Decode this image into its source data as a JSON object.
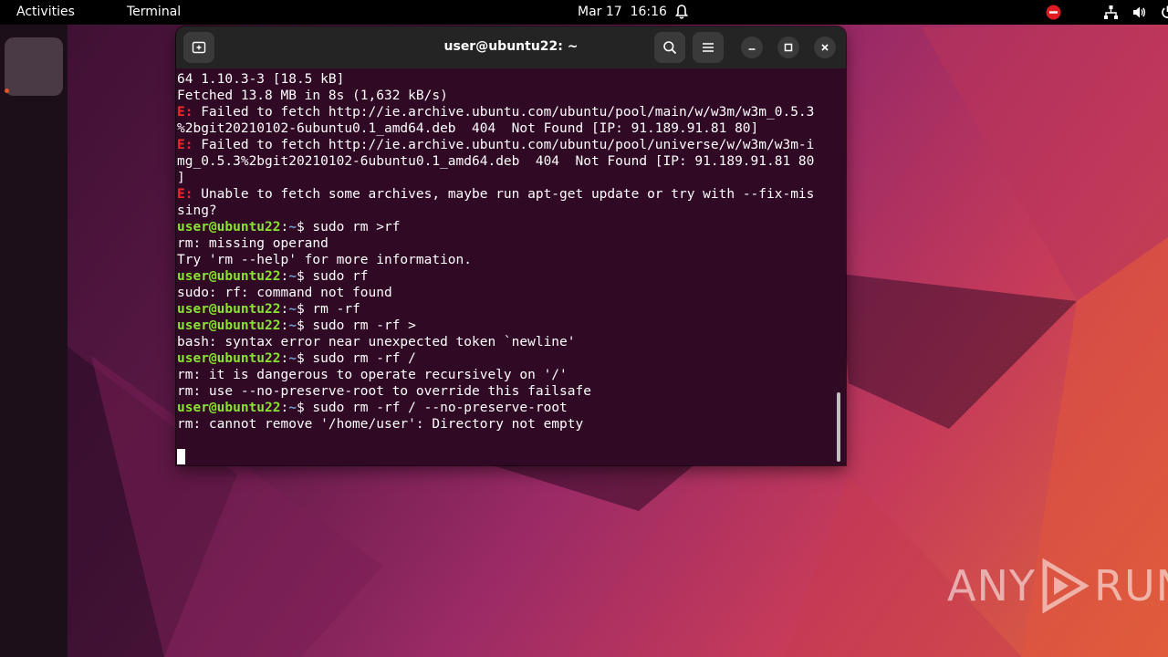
{
  "topbar": {
    "activities": "Activities",
    "app_name": "Terminal",
    "date": "Mar 17",
    "time": "16:16"
  },
  "terminal": {
    "title": "user@ubuntu22: ~",
    "lines": [
      [
        {
          "t": "64 1.10.3-3 [18.5 kB]",
          "c": ""
        }
      ],
      [
        {
          "t": "Fetched 13.8 MB in 8s (1,632 kB/s)",
          "c": ""
        }
      ],
      [
        {
          "t": "E:",
          "c": "err"
        },
        {
          "t": " Failed to fetch http://ie.archive.ubuntu.com/ubuntu/pool/main/w/w3m/w3m_0.5.3",
          "c": ""
        }
      ],
      [
        {
          "t": "%2bgit20210102-6ubuntu0.1_amd64.deb  404  Not Found [IP: 91.189.91.81 80]",
          "c": ""
        }
      ],
      [
        {
          "t": "E:",
          "c": "err"
        },
        {
          "t": " Failed to fetch http://ie.archive.ubuntu.com/ubuntu/pool/universe/w/w3m/w3m-i",
          "c": ""
        }
      ],
      [
        {
          "t": "mg_0.5.3%2bgit20210102-6ubuntu0.1_amd64.deb  404  Not Found [IP: 91.189.91.81 80",
          "c": ""
        }
      ],
      [
        {
          "t": "]",
          "c": ""
        }
      ],
      [
        {
          "t": "E:",
          "c": "err"
        },
        {
          "t": " Unable to fetch some archives, maybe run apt-get update or try with --fix-mis",
          "c": ""
        }
      ],
      [
        {
          "t": "sing?",
          "c": ""
        }
      ],
      [
        {
          "t": "user@ubuntu22",
          "c": "pu"
        },
        {
          "t": ":",
          "c": ""
        },
        {
          "t": "~",
          "c": "pp"
        },
        {
          "t": "$ sudo rm >rf",
          "c": ""
        }
      ],
      [
        {
          "t": "rm: missing operand",
          "c": ""
        }
      ],
      [
        {
          "t": "Try 'rm --help' for more information.",
          "c": ""
        }
      ],
      [
        {
          "t": "user@ubuntu22",
          "c": "pu"
        },
        {
          "t": ":",
          "c": ""
        },
        {
          "t": "~",
          "c": "pp"
        },
        {
          "t": "$ sudo rf",
          "c": ""
        }
      ],
      [
        {
          "t": "sudo: rf: command not found",
          "c": ""
        }
      ],
      [
        {
          "t": "user@ubuntu22",
          "c": "pu"
        },
        {
          "t": ":",
          "c": ""
        },
        {
          "t": "~",
          "c": "pp"
        },
        {
          "t": "$ rm -rf",
          "c": ""
        }
      ],
      [
        {
          "t": "user@ubuntu22",
          "c": "pu"
        },
        {
          "t": ":",
          "c": ""
        },
        {
          "t": "~",
          "c": "pp"
        },
        {
          "t": "$ sudo rm -rf >",
          "c": ""
        }
      ],
      [
        {
          "t": "bash: syntax error near unexpected token `newline'",
          "c": ""
        }
      ],
      [
        {
          "t": "user@ubuntu22",
          "c": "pu"
        },
        {
          "t": ":",
          "c": ""
        },
        {
          "t": "~",
          "c": "pp"
        },
        {
          "t": "$ sudo rm -rf /",
          "c": ""
        }
      ],
      [
        {
          "t": "rm: it is dangerous to operate recursively on '/'",
          "c": ""
        }
      ],
      [
        {
          "t": "rm: use --no-preserve-root to override this failsafe",
          "c": ""
        }
      ],
      [
        {
          "t": "user@ubuntu22",
          "c": "pu"
        },
        {
          "t": ":",
          "c": ""
        },
        {
          "t": "~",
          "c": "pp"
        },
        {
          "t": "$ sudo rm -rf / --no-preserve-root",
          "c": ""
        }
      ],
      [
        {
          "t": "rm: cannot remove '/home/user': Directory not empty",
          "c": ""
        }
      ],
      [
        {
          "t": "",
          "c": ""
        }
      ]
    ]
  },
  "watermark": {
    "left": "ANY",
    "right": "RUN"
  },
  "icons": {
    "bell": "notification-bell-icon",
    "network": "network-icon",
    "volume": "volume-icon",
    "power": "power-icon",
    "do_not_disturb": "do-not-disturb-icon"
  },
  "colors": {
    "terminal_bg": "#300a24",
    "error": "#ef2929",
    "prompt_user": "#8ae234",
    "prompt_path": "#729fcf",
    "accent": "#e95420"
  }
}
